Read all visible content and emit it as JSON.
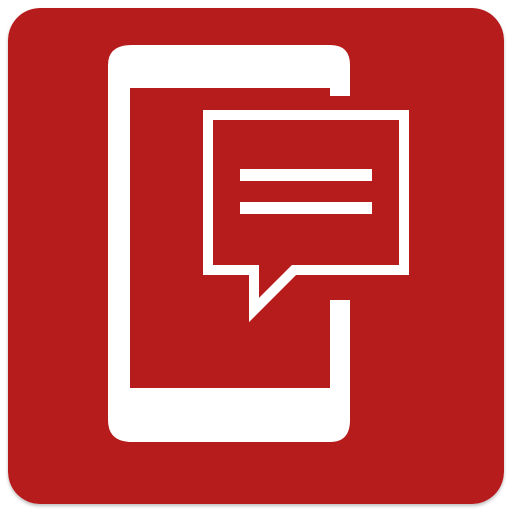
{
  "icon": {
    "name": "phone-message-app-icon",
    "glyph": "smartphone-with-chat-bubble",
    "colors": {
      "background": "#B71C1C",
      "foreground": "#FFFFFF"
    }
  }
}
